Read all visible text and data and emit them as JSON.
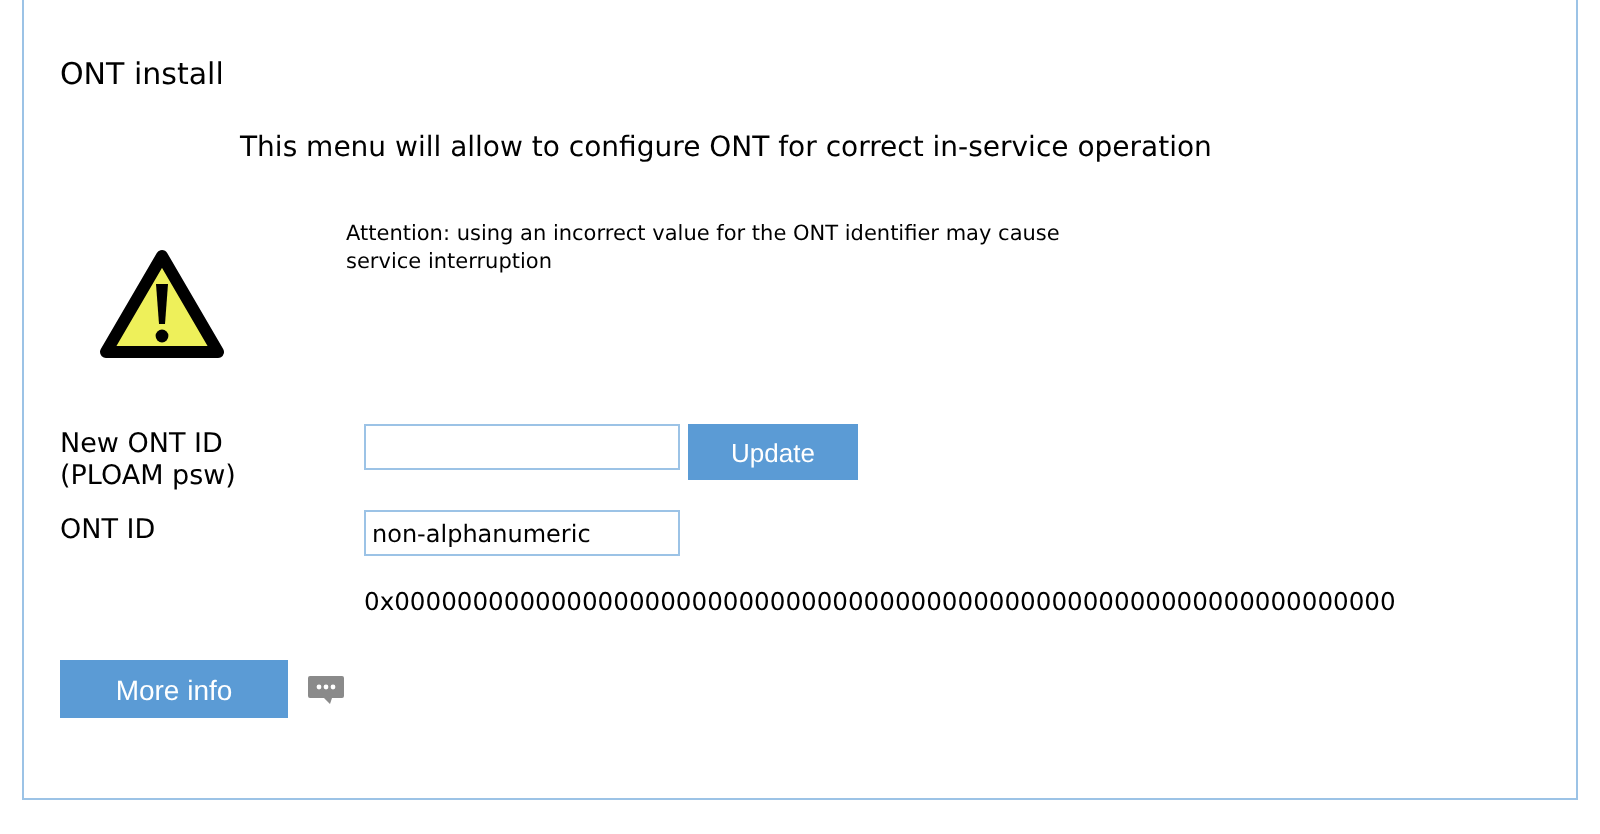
{
  "title": "ONT install",
  "intro": "This menu will allow to configure ONT for correct in-service operation",
  "warning": "Attention: using an incorrect value for the ONT identifier may cause service interruption",
  "fields": [
    {
      "label": "New ONT ID\n(PLOAM psw)",
      "button": "Update"
    },
    {
      "label": "ONT ID",
      "value": "non-alphanumeric"
    }
  ],
  "hex_value": "0x0000000000000000000000000000000000000000000000000000000000000000",
  "more_info_button": "More info"
}
